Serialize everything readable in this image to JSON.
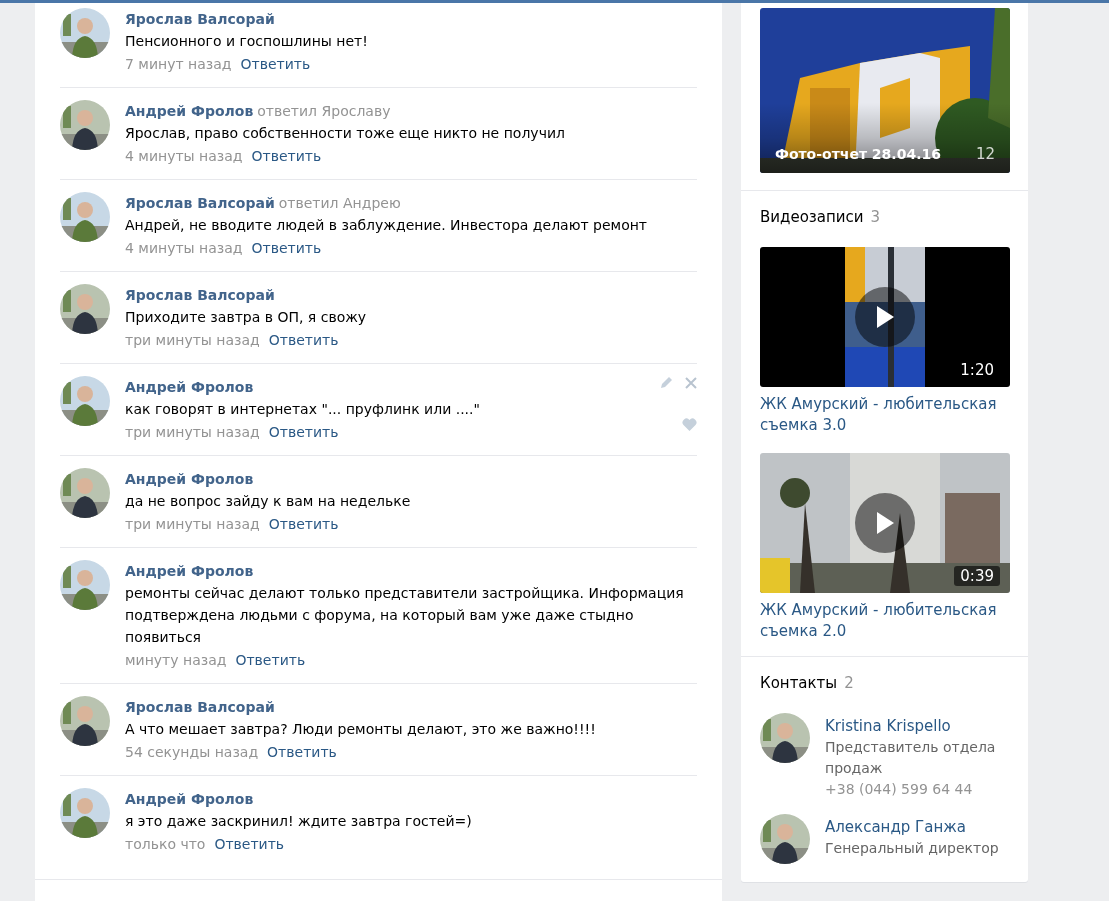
{
  "comments": [
    {
      "author": "Ярослав Валсорай",
      "text": "Пенсионного и госпошлины нет!",
      "time": "7 минут назад",
      "reply": "Ответить",
      "actions_visible": false
    },
    {
      "author": "Андрей Фролов",
      "reply_to": "ответил Ярославу",
      "text": "Ярослав, право собственности тоже еще никто не получил",
      "time": "4 минуты назад",
      "reply": "Ответить",
      "actions_visible": false
    },
    {
      "author": "Ярослав Валсорай",
      "reply_to": "ответил Андрею",
      "text": "Андрей, не вводите людей в заблуждение. Инвестора делают ремонт",
      "time": "4 минуты назад",
      "reply": "Ответить",
      "actions_visible": false
    },
    {
      "author": "Ярослав Валсорай",
      "text": "Приходите завтра в ОП, я свожу",
      "time": "три минуты назад",
      "reply": "Ответить",
      "actions_visible": false
    },
    {
      "author": "Андрей Фролов",
      "text": "как говорят в интернетах \"... пруфлинк или ....\"",
      "time": "три минуты назад",
      "reply": "Ответить",
      "actions_visible": true
    },
    {
      "author": "Андрей Фролов",
      "text": "да не вопрос зайду к вам на недельке",
      "time": "три минуты назад",
      "reply": "Ответить",
      "actions_visible": false
    },
    {
      "author": "Андрей Фролов",
      "text": "ремонты сейчас делают только представители застройщика. Информация подтверждена людьми с форума, на который вам уже даже стыдно появиться",
      "time": "минуту назад",
      "reply": "Ответить",
      "actions_visible": false
    },
    {
      "author": "Ярослав Валсорай",
      "text": "А что мешает завтра? Люди ремонты делают, это же важно!!!!",
      "time": "54 секунды назад",
      "reply": "Ответить",
      "actions_visible": false
    },
    {
      "author": "Андрей Фролов",
      "text": "я это даже заскринил! ждите завтра гостей=)",
      "time": "только что",
      "reply": "Ответить",
      "actions_visible": false
    }
  ],
  "album": {
    "title": "Фото-отчет 28.04.16",
    "count": "12"
  },
  "videos": {
    "title": "Видеозаписи",
    "count": "3",
    "items": [
      {
        "duration": "1:20",
        "title": "ЖК Амурский - любительская съемка 3.0"
      },
      {
        "duration": "0:39",
        "title": "ЖК Амурский - любительская съемка 2.0"
      }
    ]
  },
  "contacts": {
    "title": "Контакты",
    "count": "2",
    "items": [
      {
        "name": "Kristina Krispello",
        "role": "Представитель отдела продаж",
        "phone": "+38 (044) 599 64 44"
      },
      {
        "name": "Александр Ганжа",
        "role": "Генеральный директор"
      }
    ]
  }
}
